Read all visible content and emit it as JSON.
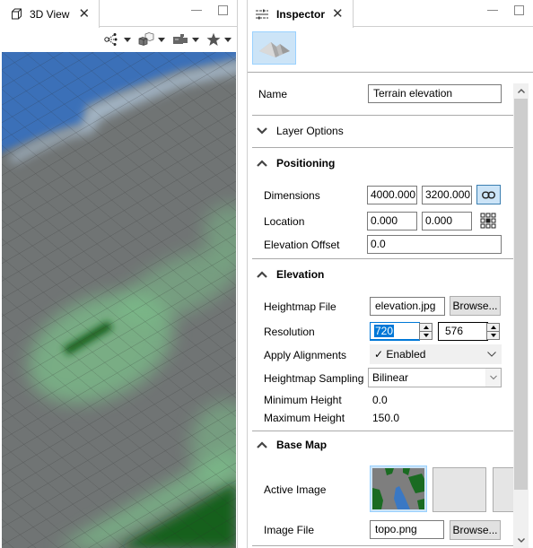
{
  "view_panel": {
    "tab_label": "3D View",
    "icons": {
      "tab": "cube-outline-icon",
      "close": "close-icon",
      "minimize": "minimize-icon",
      "maximize": "maximize-icon"
    },
    "toolbar": [
      {
        "name": "scene-graph",
        "icon": "node-graph-icon"
      },
      {
        "name": "objects",
        "icon": "boxes-icon"
      },
      {
        "name": "camera",
        "icon": "video-camera-icon"
      },
      {
        "name": "favorites",
        "icon": "star-icon"
      }
    ],
    "colors": {
      "water": "#3a6fb8",
      "land": "#6f7373",
      "vegetation_light": "#7cc08a",
      "vegetation_dark": "#15601f"
    }
  },
  "inspector": {
    "tab_label": "Inspector",
    "icons": {
      "tab": "sliders-icon",
      "close": "close-icon",
      "layer_type": "terrain-mountain-icon"
    },
    "name": {
      "label": "Name",
      "value": "Terrain elevation"
    },
    "sections": {
      "layer_options": {
        "title": "Layer Options",
        "expanded": false
      },
      "positioning": {
        "title": "Positioning",
        "expanded": true,
        "dimensions": {
          "label": "Dimensions",
          "width": "4000.000",
          "height": "3200.000",
          "link_icon": "chain-link-icon",
          "linked": true
        },
        "location": {
          "label": "Location",
          "x": "0.000",
          "y": "0.000",
          "anchor_icon": "anchor-grid-icon"
        },
        "elevation_offset": {
          "label": "Elevation Offset",
          "value": "0.0"
        }
      },
      "elevation": {
        "title": "Elevation",
        "expanded": true,
        "heightmap_file": {
          "label": "Heightmap File",
          "value": "elevation.jpg",
          "browse": "Browse..."
        },
        "resolution": {
          "label": "Resolution",
          "x": "720",
          "y": "576"
        },
        "apply_alignments": {
          "label": "Apply Alignments",
          "value": "✓ Enabled"
        },
        "heightmap_sampling": {
          "label": "Heightmap Sampling",
          "value": "Bilinear"
        },
        "minimum_height": {
          "label": "Minimum Height",
          "value": "0.0"
        },
        "maximum_height": {
          "label": "Maximum Height",
          "value": "150.0"
        }
      },
      "base_map": {
        "title": "Base Map",
        "expanded": true,
        "active_image": {
          "label": "Active Image"
        },
        "image_file": {
          "label": "Image File",
          "value": "topo.png",
          "browse": "Browse..."
        }
      }
    },
    "scrollbar": {
      "position": 0.0,
      "visible_fraction": 0.85
    }
  }
}
